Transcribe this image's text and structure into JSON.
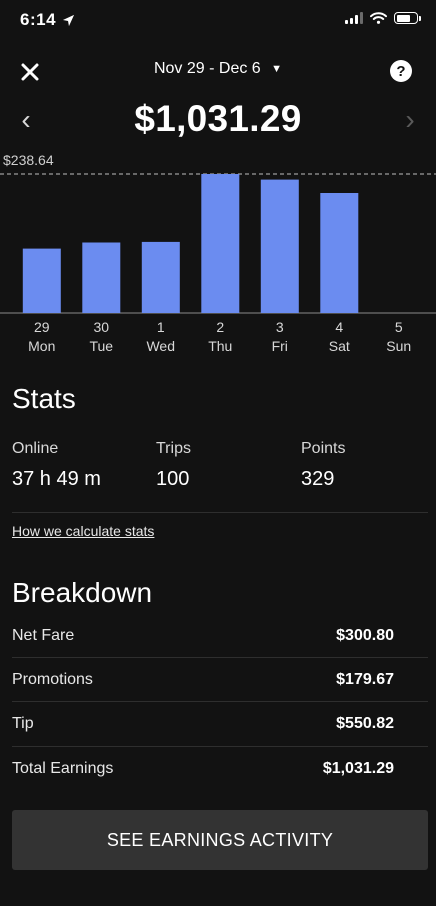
{
  "status_bar": {
    "time": "6:14"
  },
  "header": {
    "date_range": "Nov 29 - Dec 6",
    "total_earnings": "$1,031.29"
  },
  "colors": {
    "bar": "#6b8cf0",
    "background": "#121212",
    "button": "#333333"
  },
  "chart_data": {
    "type": "bar",
    "categories": [
      "29 Mon",
      "30 Tue",
      "1 Wed",
      "2 Thu",
      "3 Fri",
      "4 Sat",
      "5 Sun"
    ],
    "values": [
      110.5,
      121.0,
      122.0,
      238.64,
      229.0,
      206.0,
      0
    ],
    "max_line_label": "$238.64",
    "ylim": [
      0,
      238.64
    ],
    "days": [
      {
        "num": "29",
        "name": "Mon"
      },
      {
        "num": "30",
        "name": "Tue"
      },
      {
        "num": "1",
        "name": "Wed"
      },
      {
        "num": "2",
        "name": "Thu"
      },
      {
        "num": "3",
        "name": "Fri"
      },
      {
        "num": "4",
        "name": "Sat"
      },
      {
        "num": "5",
        "name": "Sun"
      }
    ]
  },
  "stats": {
    "title": "Stats",
    "items": [
      {
        "label": "Online",
        "value": "37 h 49 m"
      },
      {
        "label": "Trips",
        "value": "100"
      },
      {
        "label": "Points",
        "value": "329"
      }
    ],
    "link": "How we calculate stats"
  },
  "breakdown": {
    "title": "Breakdown",
    "rows": [
      {
        "label": "Net Fare",
        "value": "$300.80"
      },
      {
        "label": "Promotions",
        "value": "$179.67"
      },
      {
        "label": "Tip",
        "value": "$550.82"
      },
      {
        "label": "Total Earnings",
        "value": "$1,031.29"
      }
    ]
  },
  "cta": {
    "label": "SEE EARNINGS ACTIVITY"
  }
}
